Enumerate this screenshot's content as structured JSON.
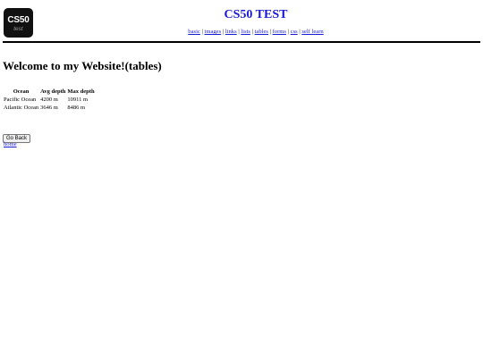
{
  "header": {
    "logo_main": "CS50",
    "logo_sub": "test",
    "site_title": "CS50 TEST",
    "nav": [
      {
        "label": "basic"
      },
      {
        "label": "images"
      },
      {
        "label": "links"
      },
      {
        "label": "lists"
      },
      {
        "label": "tables"
      },
      {
        "label": "forms"
      },
      {
        "label": "css"
      },
      {
        "label": "self learn"
      }
    ],
    "separator": "|"
  },
  "main": {
    "heading": "Welcome to my Website!(tables)",
    "table": {
      "headers": [
        "Ocean",
        "Avg depth",
        "Max depth"
      ],
      "rows": [
        [
          "Pacific Ocean",
          "4200 m",
          "10911 m"
        ],
        [
          "Atlantic Ocean",
          "3646 m",
          "8486 m"
        ]
      ]
    },
    "back_button": "Go Back",
    "home_link": "home"
  }
}
